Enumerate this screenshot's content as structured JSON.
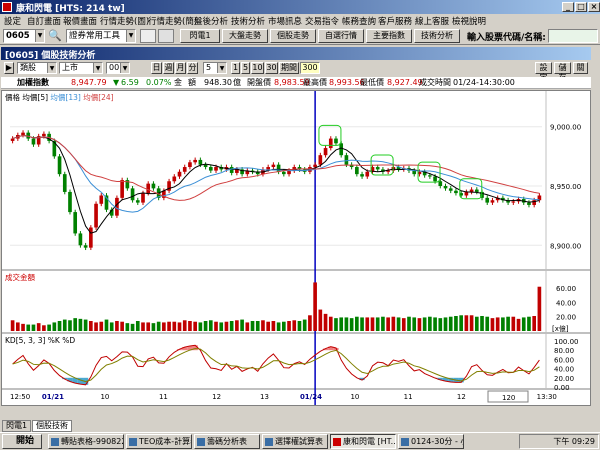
{
  "window": {
    "title": "康和閃電 [HTS: 214 tw]"
  },
  "menu": [
    "設定",
    "自訂畫面",
    "報價畫面",
    "行情走勢(圖)",
    "行情走勢(簡)",
    "盤後分析",
    "技術分析",
    "市場訊息",
    "交易指令",
    "帳務查詢",
    "客戶服務",
    "線上客服",
    "檢視說明"
  ],
  "toolbar": {
    "code": "0605",
    "tool_select": "證券常用工具",
    "buttons": [
      "閃電1",
      "大盤走勢",
      "個股走勢",
      "自選行情",
      "主要指數",
      "技術分析"
    ],
    "input_label": "輸入股票代碼/名稱:"
  },
  "inner_window": {
    "title": "[0605] 個股技術分析",
    "btn_settings": "設定",
    "btn_save": "儲存",
    "btn_close": "關"
  },
  "controls": {
    "market": "類股",
    "exchange": "上市",
    "item": "001",
    "periods": [
      "日",
      "週",
      "月",
      "分"
    ],
    "minute": "5",
    "minutes": [
      "1",
      "5",
      "10",
      "30"
    ],
    "intraday_label": "期間",
    "count": "300"
  },
  "info": {
    "name": "加權指數",
    "last": "8,947.79",
    "change_sign": "▼",
    "change": "6.59",
    "pct": "0.07%",
    "amount_label": "金",
    "amount_label2": "額",
    "amount": "948.30",
    "amount_unit": "億",
    "open_label": "開盤價",
    "open": "8,983.59",
    "high_label": "最高價",
    "high": "8,993.56",
    "low_label": "最低價",
    "low": "8,927.49",
    "time_label": "成交時間",
    "time": "01/24-14:30:00"
  },
  "price_panel": {
    "label_price": "價格",
    "label_ma": "均價[5]",
    "label_ma2": "均價[13]",
    "label_ma3": "均價[24]",
    "yticks": [
      9000,
      8950,
      8900
    ],
    "ytick_labels": [
      "9,000.00",
      "8,950.00",
      "8,900.00"
    ]
  },
  "volume_panel": {
    "label": "成交金額",
    "yticks": [
      "60.00",
      "40.00",
      "20.00"
    ],
    "unit": "[x億]"
  },
  "kd_panel": {
    "label": "KD[5, 3, 3] %K %D",
    "yticks": [
      "100.00",
      "80.00",
      "60.00",
      "40.00",
      "20.00",
      "0.00"
    ]
  },
  "xaxis": {
    "labels": [
      "12:50",
      "01/21",
      "10",
      "11",
      "12",
      "13",
      "01/24",
      "10",
      "11",
      "12",
      "13",
      "13:30"
    ],
    "zoom": "120"
  },
  "colors": {
    "up": "#c00000",
    "down": "#008000",
    "ma1": "#000000",
    "ma2": "#3b8fd6",
    "ma3": "#d04040",
    "kd1": "#c00000",
    "kd2": "#808000"
  },
  "chart_data": {
    "type": "candlestick",
    "ylim": [
      8880,
      9020
    ],
    "closes": [
      8990,
      8993,
      8995,
      8990,
      8985,
      8992,
      8994,
      8988,
      8975,
      8960,
      8945,
      8928,
      8910,
      8900,
      8898,
      8915,
      8935,
      8942,
      8930,
      8925,
      8940,
      8955,
      8948,
      8938,
      8936,
      8944,
      8952,
      8948,
      8940,
      8946,
      8954,
      8958,
      8962,
      8966,
      8970,
      8972,
      8968,
      8966,
      8963,
      8966,
      8964,
      8966,
      8961,
      8964,
      8960,
      8963,
      8962,
      8960,
      8964,
      8966,
      8968,
      8962,
      8960,
      8963,
      8966,
      8964,
      8962,
      8966,
      8968,
      8976,
      8982,
      8990,
      8986,
      8976,
      8968,
      8966,
      8960,
      8958,
      8962,
      8966,
      8964,
      8962,
      8963,
      8966,
      8964,
      8965,
      8963,
      8960,
      8962,
      8959,
      8958,
      8954,
      8950,
      8948,
      8946,
      8944,
      8942,
      8945,
      8947,
      8945,
      8940,
      8936,
      8938,
      8940,
      8938,
      8936,
      8937,
      8939,
      8936,
      8934,
      8938,
      8942
    ],
    "volume": [
      15,
      12,
      10,
      9,
      9,
      11,
      8,
      9,
      12,
      14,
      16,
      15,
      18,
      17,
      16,
      14,
      12,
      13,
      16,
      12,
      14,
      13,
      11,
      10,
      14,
      12,
      12,
      11,
      13,
      12,
      13,
      13,
      12,
      15,
      14,
      13,
      12,
      14,
      15,
      13,
      12,
      13,
      14,
      15,
      16,
      12,
      14,
      14,
      15,
      13,
      14,
      12,
      13,
      14,
      15,
      14,
      16,
      22,
      68,
      30,
      24,
      20,
      18,
      19,
      19,
      18,
      20,
      19,
      19,
      19,
      19,
      20,
      19,
      20,
      19,
      18,
      20,
      19,
      18,
      19,
      20,
      19,
      18,
      19,
      20,
      21,
      22,
      22,
      22,
      20,
      21,
      20,
      18,
      19,
      19,
      20,
      20,
      17,
      19,
      20,
      21,
      62
    ],
    "highlight_boxes_label": "green markers"
  }
}
